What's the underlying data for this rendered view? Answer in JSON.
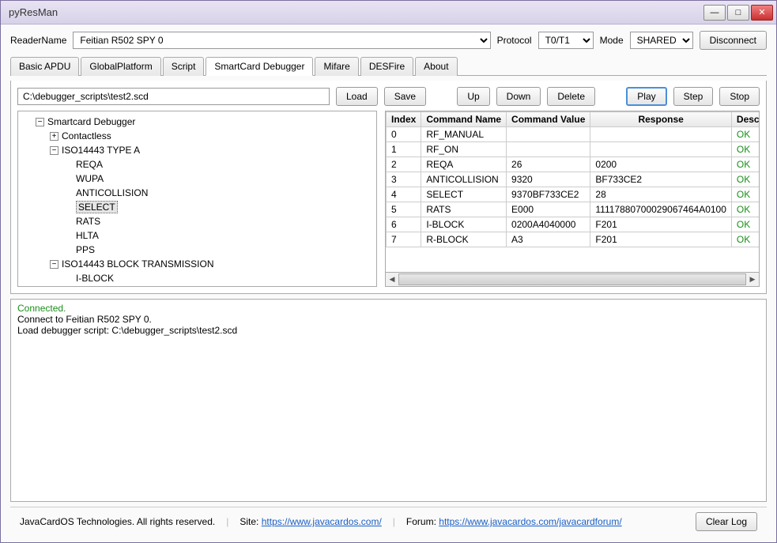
{
  "window": {
    "title": "pyResMan"
  },
  "toprow": {
    "readerLabel": "ReaderName",
    "readerValue": "Feitian R502 SPY 0",
    "protocolLabel": "Protocol",
    "protocolValue": "T0/T1",
    "modeLabel": "Mode",
    "modeValue": "SHARED",
    "disconnect": "Disconnect"
  },
  "tabs": [
    "Basic APDU",
    "GlobalPlatform",
    "Script",
    "SmartCard Debugger",
    "Mifare",
    "DESFire",
    "About"
  ],
  "activeTab": 3,
  "toolbar": {
    "path": "C:\\debugger_scripts\\test2.scd",
    "load": "Load",
    "save": "Save",
    "up": "Up",
    "down": "Down",
    "delete": "Delete",
    "play": "Play",
    "step": "Step",
    "stop": "Stop"
  },
  "tree": {
    "root": "Smartcard Debugger",
    "nodes": [
      {
        "label": "Contactless",
        "expanded": false
      },
      {
        "label": "ISO14443 TYPE A",
        "expanded": true,
        "children": [
          "REQA",
          "WUPA",
          "ANTICOLLISION",
          "SELECT",
          "RATS",
          "HLTA",
          "PPS"
        ],
        "selected": "SELECT"
      },
      {
        "label": "ISO14443 BLOCK TRANSMISSION",
        "expanded": true,
        "children": [
          "I-BLOCK"
        ]
      }
    ]
  },
  "table": {
    "headers": [
      "Index",
      "Command Name",
      "Command Value",
      "Response",
      "Descriptio"
    ],
    "rows": [
      {
        "idx": "0",
        "name": "RF_MANUAL",
        "value": "",
        "resp": "",
        "desc": "OK"
      },
      {
        "idx": "1",
        "name": "RF_ON",
        "value": "",
        "resp": "",
        "desc": "OK"
      },
      {
        "idx": "2",
        "name": "REQA",
        "value": "26",
        "resp": "0200",
        "desc": "OK"
      },
      {
        "idx": "3",
        "name": "ANTICOLLISION",
        "value": "9320",
        "resp": "BF733CE2",
        "desc": "OK"
      },
      {
        "idx": "4",
        "name": "SELECT",
        "value": "9370BF733CE2",
        "resp": "28",
        "desc": "OK"
      },
      {
        "idx": "5",
        "name": "RATS",
        "value": "E000",
        "resp": "11117880700029067464A0100",
        "desc": "OK"
      },
      {
        "idx": "6",
        "name": "I-BLOCK",
        "value": "0200A4040000",
        "resp": "F201",
        "desc": "OK"
      },
      {
        "idx": "7",
        "name": "R-BLOCK",
        "value": "A3",
        "resp": "F201",
        "desc": "OK"
      }
    ]
  },
  "log": {
    "lines": [
      {
        "text": "Connected.",
        "ok": true
      },
      {
        "text": "Connect to Feitian R502 SPY 0.",
        "ok": false
      },
      {
        "text": "Load debugger script: C:\\debugger_scripts\\test2.scd",
        "ok": false
      }
    ]
  },
  "footer": {
    "copy": "JavaCardOS Technologies. All rights reserved.",
    "siteLabel": "Site: ",
    "siteUrl": "https://www.javacardos.com/",
    "forumLabel": "Forum: ",
    "forumUrl": "https://www.javacardos.com/javacardforum/",
    "clearLog": "Clear Log"
  }
}
